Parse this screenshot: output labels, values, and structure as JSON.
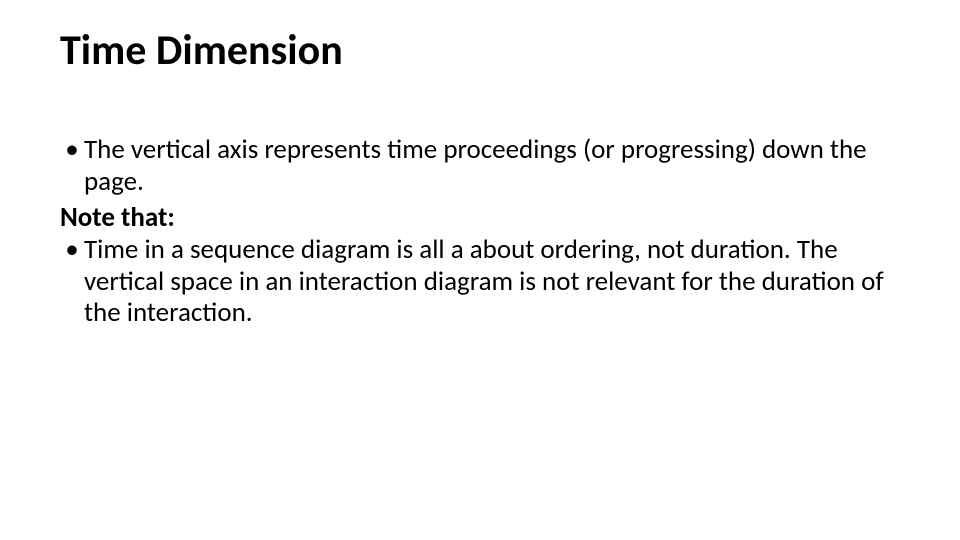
{
  "slide": {
    "title": "Time Dimension",
    "bullets": [
      "The vertical axis represents time proceedings (or progressing) down the page."
    ],
    "note_label": "Note that:",
    "bullets2": [
      "Time in a sequence diagram is all a about ordering, not duration. The vertical space in an interaction diagram is not relevant for the duration of the interaction."
    ],
    "bullet_char": "•"
  }
}
